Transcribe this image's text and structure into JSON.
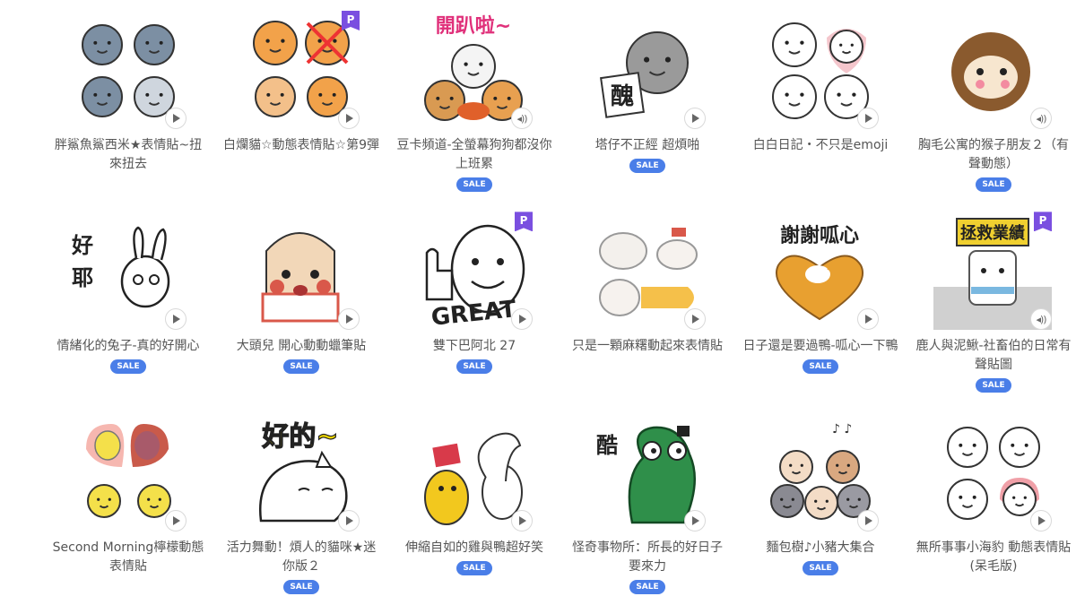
{
  "accent": {
    "sale_bg": "#4a7ee8",
    "premium_badge_bg": "#7a4fe0",
    "title_text": "#555555"
  },
  "stickers": [
    {
      "title": "胖鯊魚鯊西米★表情貼~扭來扭去",
      "sale": false,
      "premium": false,
      "sound": false,
      "icon": "shark-sticker-icon",
      "bg": "#ffffff",
      "main": "#7c8fa3"
    },
    {
      "title": "白爛貓☆動態表情貼☆第9彈",
      "sale": false,
      "premium": true,
      "sound": false,
      "icon": "white-cat-sticker-icon",
      "bg": "#ffffff",
      "main": "#f2a24a"
    },
    {
      "title": "豆卡頻道-全螢幕狗狗都沒你上班累",
      "sale": true,
      "sale_label": "SALE",
      "premium": false,
      "sound": true,
      "icon": "dog-group-sticker-icon",
      "bg": "#ffffff",
      "main": "#d99a52"
    },
    {
      "title": "塔仔不正經 超煩啪",
      "sale": true,
      "sale_label": "SALE",
      "premium": false,
      "sound": false,
      "icon": "gray-cat-sticker-icon",
      "bg": "#ffffff",
      "main": "#9a9a9a"
    },
    {
      "title": "白白日記・不只是emoji",
      "sale": false,
      "premium": false,
      "sound": false,
      "icon": "white-bear-sticker-icon",
      "bg": "#ffffff",
      "main": "#f4c6cc"
    },
    {
      "title": "胸毛公寓的猴子朋友２（有聲動態）",
      "sale": true,
      "sale_label": "SALE",
      "premium": false,
      "sound": true,
      "icon": "monkey-sticker-icon",
      "bg": "#ffffff",
      "main": "#8a5a2e"
    },
    {
      "title": "情緒化的兔子-真的好開心",
      "sale": true,
      "sale_label": "SALE",
      "premium": false,
      "sound": false,
      "icon": "rabbit-sticker-icon",
      "bg": "#ffffff",
      "main": "#222222"
    },
    {
      "title": "大頭兒 開心動動蠟筆貼",
      "sale": true,
      "sale_label": "SALE",
      "premium": false,
      "sound": false,
      "icon": "big-head-girl-sticker-icon",
      "bg": "#ffffff",
      "main": "#d9584a"
    },
    {
      "title": "雙下巴阿北 27",
      "sale": true,
      "sale_label": "SALE",
      "premium": true,
      "sound": false,
      "icon": "uncle-great-sticker-icon",
      "bg": "#ffffff",
      "main": "#333333"
    },
    {
      "title": "只是一顆麻糬動起來表情貼",
      "sale": false,
      "premium": false,
      "sound": false,
      "icon": "mochi-sticker-icon",
      "bg": "#ffffff",
      "main": "#f5c04a"
    },
    {
      "title": "日子還是要過鴨-呱心一下鴨",
      "sale": true,
      "sale_label": "SALE",
      "premium": false,
      "sound": false,
      "icon": "duck-heart-sticker-icon",
      "bg": "#ffffff",
      "main": "#e8a030"
    },
    {
      "title": "鹿人與泥鰍-社畜伯的日常有聲貼圖",
      "sale": true,
      "sale_label": "SALE",
      "premium": true,
      "sound": true,
      "icon": "office-worker-sticker-icon",
      "bg": "#ffffff",
      "main": "#f0d030"
    },
    {
      "title": "Second Morning檸檬動態表情貼",
      "sale": false,
      "premium": false,
      "sound": false,
      "icon": "lemon-sticker-icon",
      "bg": "#ffffff",
      "main": "#f4e04a"
    },
    {
      "title": "活力舞動！煩人的貓咪★迷你版２",
      "sale": true,
      "sale_label": "SALE",
      "premium": false,
      "sound": false,
      "icon": "annoying-cat-sticker-icon",
      "bg": "#ffffff",
      "main": "#f0d800"
    },
    {
      "title": "伸縮自如的雞與鴨超好笑",
      "sale": true,
      "sale_label": "SALE",
      "premium": false,
      "sound": false,
      "icon": "chicken-duck-sticker-icon",
      "bg": "#ffffff",
      "main": "#f2c81e"
    },
    {
      "title": "怪奇事物所：所長的好日子要來力",
      "sale": true,
      "sale_label": "SALE",
      "premium": false,
      "sound": false,
      "icon": "green-frog-sticker-icon",
      "bg": "#ffffff",
      "main": "#2f8f4a"
    },
    {
      "title": "麵包樹♪小豬大集合",
      "sale": true,
      "sale_label": "SALE",
      "premium": false,
      "sound": false,
      "icon": "piggy-group-sticker-icon",
      "bg": "#ffffff",
      "main": "#c99a78"
    },
    {
      "title": "無所事事小海豹 動態表情貼(呆毛版)",
      "sale": false,
      "premium": false,
      "sound": false,
      "icon": "seal-sticker-icon",
      "bg": "#ffffff",
      "main": "#f0a0a8"
    }
  ],
  "strings": {
    "premium_badge": "P",
    "sale_label": "SALE",
    "sound_icon": "◂))"
  },
  "sticker_texts": {
    "s2": "開趴啦~",
    "s4": "醜",
    "s7": "好耶",
    "s9": "GREAT",
    "s11": "謝謝呱心",
    "s12": "拯救業績",
    "s14": "好的~",
    "s16": "酷"
  }
}
